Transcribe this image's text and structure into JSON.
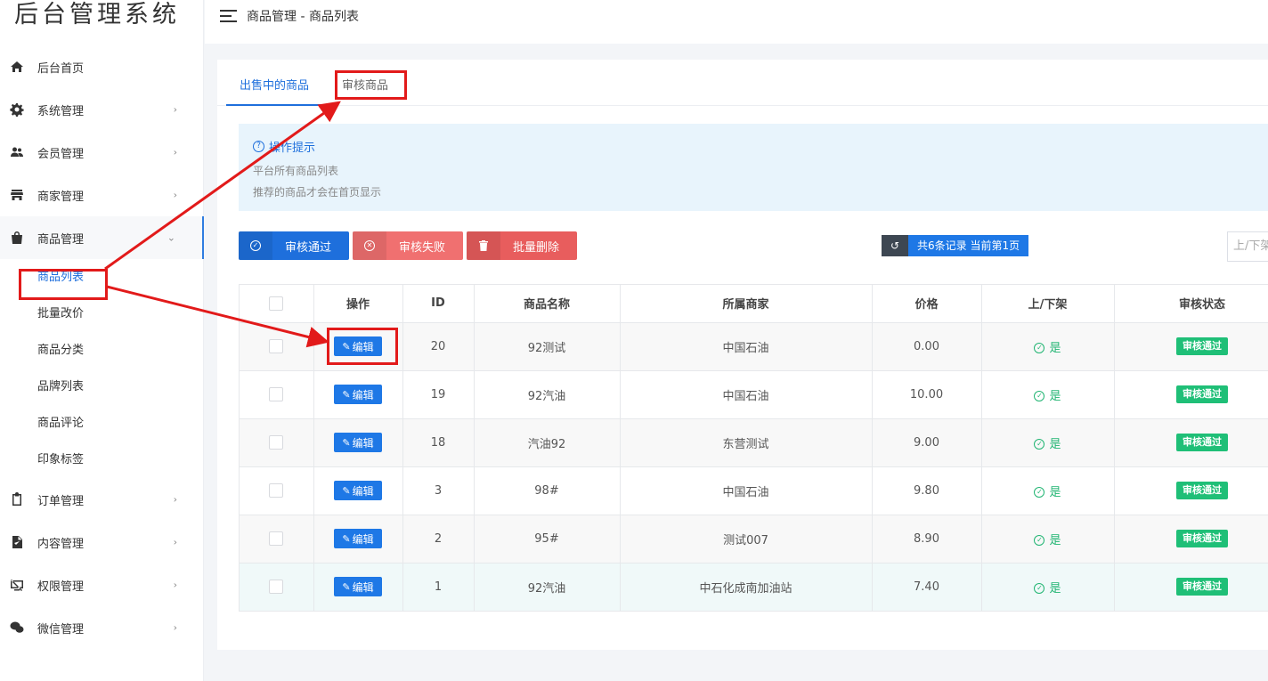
{
  "app": {
    "title": "后台管理系统"
  },
  "header": {
    "breadcrumb": "商品管理 - 商品列表"
  },
  "sidebar": {
    "items": [
      {
        "label": "后台首页",
        "icon": "home-icon"
      },
      {
        "label": "系统管理",
        "icon": "gear-icon"
      },
      {
        "label": "会员管理",
        "icon": "users-icon"
      },
      {
        "label": "商家管理",
        "icon": "store-icon"
      },
      {
        "label": "商品管理",
        "icon": "shopping-bag-icon"
      },
      {
        "label": "订单管理",
        "icon": "clipboard-icon"
      },
      {
        "label": "内容管理",
        "icon": "document-icon"
      },
      {
        "label": "权限管理",
        "icon": "monitor-off-icon"
      },
      {
        "label": "微信管理",
        "icon": "wechat-icon"
      }
    ],
    "submenu": [
      "商品列表",
      "批量改价",
      "商品分类",
      "品牌列表",
      "商品评论",
      "印象标签"
    ]
  },
  "tabs": [
    "出售中的商品",
    "审核商品"
  ],
  "tips": {
    "title": "操作提示",
    "lines": [
      "平台所有商品列表",
      "推荐的商品才会在首页显示"
    ]
  },
  "toolbar": {
    "approve": "审核通过",
    "reject": "审核失败",
    "delete": "批量删除",
    "records": "共6条记录 当前第1页",
    "status_select": "上/下架"
  },
  "table": {
    "headers": [
      "操作",
      "ID",
      "商品名称",
      "所属商家",
      "价格",
      "上/下架",
      "审核状态"
    ],
    "edit_label": "编辑",
    "rows": [
      {
        "id": "20",
        "name": "92测试",
        "merchant": "中国石油",
        "price": "0.00",
        "on_sale": "是",
        "status": "审核通过"
      },
      {
        "id": "19",
        "name": "92汽油",
        "merchant": "中国石油",
        "price": "10.00",
        "on_sale": "是",
        "status": "审核通过"
      },
      {
        "id": "18",
        "name": "汽油92",
        "merchant": "东营测试",
        "price": "9.00",
        "on_sale": "是",
        "status": "审核通过"
      },
      {
        "id": "3",
        "name": "98#",
        "merchant": "中国石油",
        "price": "9.80",
        "on_sale": "是",
        "status": "审核通过"
      },
      {
        "id": "2",
        "name": "95#",
        "merchant": "测试007",
        "price": "8.90",
        "on_sale": "是",
        "status": "审核通过"
      },
      {
        "id": "1",
        "name": "92汽油",
        "merchant": "中石化成南加油站",
        "price": "7.40",
        "on_sale": "是",
        "status": "审核通过"
      }
    ]
  },
  "colors": {
    "primary": "#1e6fdc",
    "success": "#1fbf77",
    "danger": "#f07070",
    "annotation": "#e21a1a"
  }
}
